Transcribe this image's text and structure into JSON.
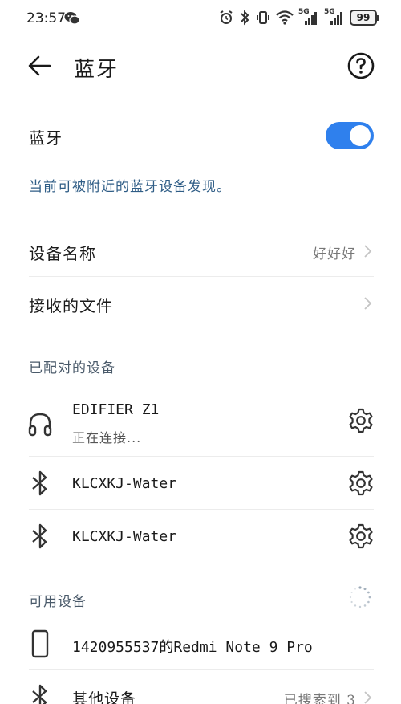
{
  "status_bar": {
    "time": "23:57",
    "battery": "99",
    "network_1": "5G",
    "network_2": "5G"
  },
  "header": {
    "title": "蓝牙"
  },
  "bluetooth_toggle": {
    "label": "蓝牙",
    "enabled": true,
    "accent_color": "#2f80ed"
  },
  "visibility_text": "当前可被附近的蓝牙设备发现。",
  "settings": [
    {
      "label": "设备名称",
      "value": "好好好"
    },
    {
      "label": "接收的文件",
      "value": ""
    }
  ],
  "paired_section": {
    "title": "已配对的设备",
    "devices": [
      {
        "name": "EDIFIER Z1",
        "status": "正在连接...",
        "icon": "headphones-icon"
      },
      {
        "name": "KLCXKJ-Water",
        "status": "",
        "icon": "bluetooth-icon"
      },
      {
        "name": "KLCXKJ-Water",
        "status": "",
        "icon": "bluetooth-icon"
      }
    ]
  },
  "available_section": {
    "title": "可用设备",
    "devices": [
      {
        "name": "1420955537的Redmi Note 9 Pro",
        "icon": "phone-icon"
      },
      {
        "name": "其他设备",
        "value": "已搜索到 3",
        "icon": "bluetooth-icon"
      }
    ]
  }
}
